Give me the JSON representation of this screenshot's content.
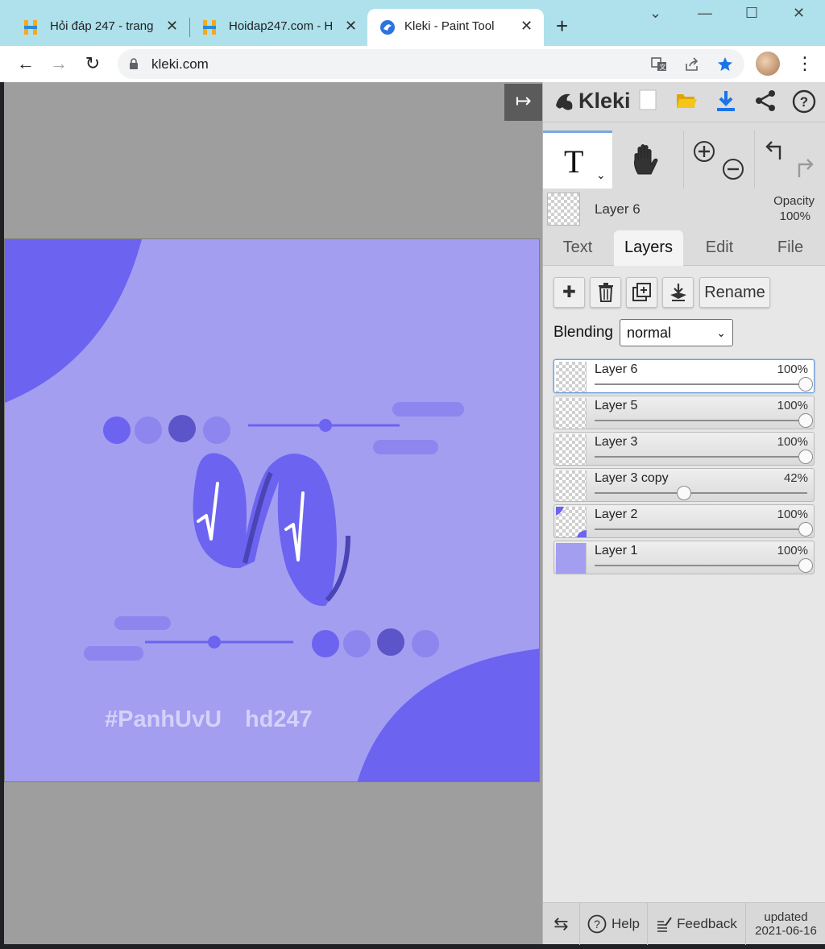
{
  "browser": {
    "tabs": [
      {
        "title": "Hỏi đáp 247 - trang",
        "close": "✕"
      },
      {
        "title": "Hoidap247.com - H",
        "close": "✕"
      },
      {
        "title": "Kleki - Paint Tool",
        "close": "✕"
      }
    ],
    "new_tab": "+",
    "window_controls": {
      "dropdown": "⌄",
      "minimize": "—",
      "maximize": "☐",
      "close": "✕"
    },
    "nav": {
      "back": "←",
      "forward": "→",
      "reload": "↻"
    },
    "url": "kleki.com",
    "icons": [
      "translate-icon",
      "share-icon",
      "star-icon"
    ]
  },
  "app": {
    "name": "Kleki",
    "collapse_glyph": "↦",
    "top_icons": [
      "new-image-icon",
      "open-folder-icon",
      "download-icon",
      "share-icon",
      "help-icon"
    ],
    "tools": {
      "text_glyph": "T",
      "hand_glyph": "✋"
    },
    "current_layer": {
      "name": "Layer 6",
      "opacity_label": "Opacity",
      "opacity_value": "100%"
    },
    "tabs": [
      {
        "label": "Text"
      },
      {
        "label": "Layers",
        "active": true
      },
      {
        "label": "Edit"
      },
      {
        "label": "File"
      }
    ],
    "layer_buttons": {
      "add": "✚",
      "delete": "🗑",
      "duplicate": "⧉",
      "merge": "⤓",
      "rename": "Rename"
    },
    "blending": {
      "label": "Blending",
      "value": "normal"
    },
    "layers": [
      {
        "name": "Layer 6",
        "opacity": "100%",
        "level": 1.0,
        "selected": true
      },
      {
        "name": "Layer 5",
        "opacity": "100%",
        "level": 1.0
      },
      {
        "name": "Layer 3",
        "opacity": "100%",
        "level": 1.0
      },
      {
        "name": "Layer 3 copy",
        "opacity": "42%",
        "level": 0.42
      },
      {
        "name": "Layer 2",
        "opacity": "100%",
        "level": 1.0
      },
      {
        "name": "Layer 1",
        "opacity": "100%",
        "level": 1.0
      }
    ],
    "bottom": {
      "help": "Help",
      "feedback": "Feedback",
      "updated_label": "updated",
      "updated_date": "2021-06-16"
    }
  },
  "canvas": {
    "tag_left": "#PanhUvU",
    "tag_right": "hd247",
    "colors": {
      "background": "#a39ef0",
      "accent": "#6c63f0",
      "dark": "#5b55c9",
      "light": "#8c86ee"
    }
  }
}
